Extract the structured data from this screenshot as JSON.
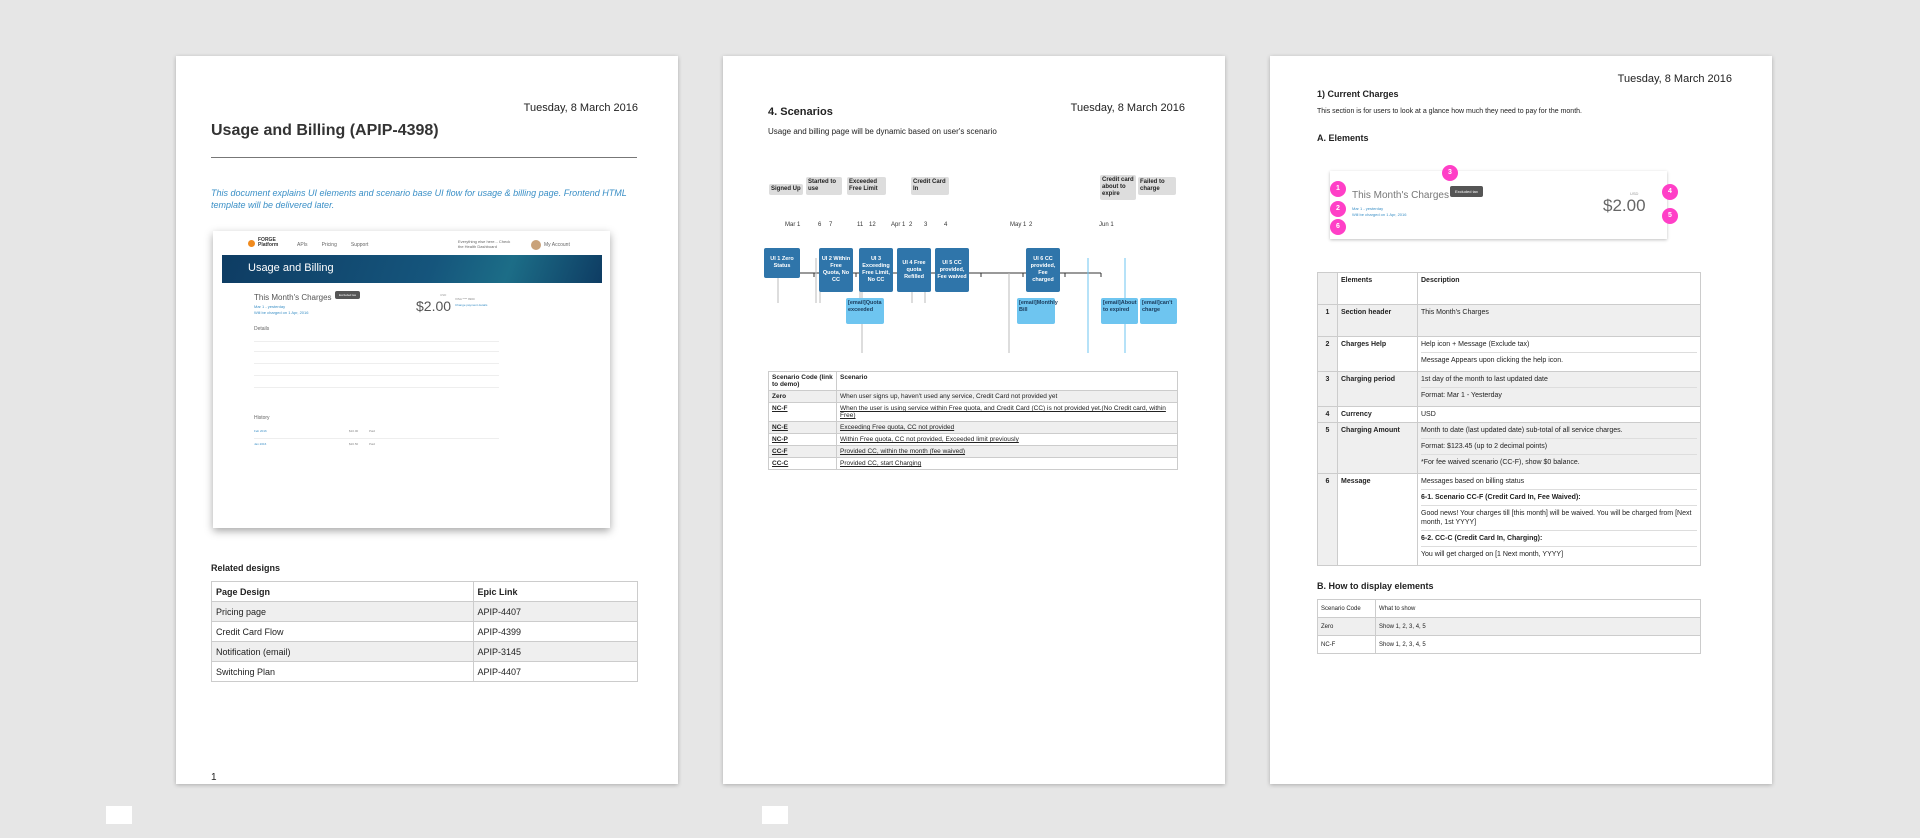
{
  "page1": {
    "date": "Tuesday, 8 March 2016",
    "title": "Usage and Billing (APIP-4398)",
    "intro": "This document explains UI elements and scenario base UI flow for usage & billing page. Frontend HTML template will be delivered later.",
    "screenshot": {
      "brand": "FORGE Platform",
      "nav": [
        "APIs",
        "Pricing",
        "Support"
      ],
      "promo": "Everything else here... Check the Health Dashboard",
      "account": "My Account",
      "banner": "Usage and Billing",
      "card_header": "This Month's Charges",
      "help_tip": "Excluded tax",
      "period_line1": "Mar 1 - yesterday",
      "period_line2": "Will be charged on 1 Apr, 2016",
      "currency": "USD",
      "amount": "$2.00",
      "card_info": "VISA **** 9900",
      "card_link": "Change payment details",
      "details_title": "Details",
      "history_title": "History",
      "history_rows": [
        {
          "month": "Feb 2016",
          "amount": "$10.00",
          "status": "Paid"
        },
        {
          "month": "Jan 2016",
          "amount": "$20.50",
          "status": "Paid"
        }
      ]
    },
    "related_heading": "Related designs",
    "related_headers": [
      "Page Design",
      "Epic Link"
    ],
    "related_rows": [
      [
        "Pricing page",
        "APIP-4407"
      ],
      [
        "Credit Card Flow",
        "APIP-4399"
      ],
      [
        "Notification (email)",
        "APIP-3145"
      ],
      [
        "Switching Plan",
        "APIP-4407"
      ]
    ],
    "page_number": "1"
  },
  "page2": {
    "date": "Tuesday, 8 March 2016",
    "title": "4. Scenarios",
    "subtitle": "Usage and billing page will be dynamic based on user's scenario",
    "events": [
      "Signed Up",
      "Started to use",
      "Exceeded Free Limit",
      "Credit Card In",
      "Credit card about to expire",
      "Failed to charge"
    ],
    "ticks": [
      "Mar 1",
      "6",
      "7",
      "11",
      "12",
      "Apr 1",
      "2",
      "3",
      "4",
      "May 1",
      "2",
      "Jun 1"
    ],
    "ui_boxes": [
      "UI 1 Zero Status",
      "UI 2 Within Free Quota, No CC",
      "UI 3 Exceeding Free Limit, No CC",
      "UI 4 Free quota Refilled",
      "UI 5 CC provided, Fee waived",
      "UI 6 CC provided, Fee charged"
    ],
    "email_boxes": [
      "[email]Quota exceeded",
      "[email]Monthly Bill",
      "[email]About to expired",
      "[email]can't charge"
    ],
    "table_headers": [
      "Scenario Code (link to demo)",
      "Scenario"
    ],
    "table_rows": [
      [
        "Zero",
        "When user signs up, haven't used any service, Credit Card not provided yet"
      ],
      [
        "NC-F",
        "When the user is using service within Free quota, and Credit Card (CC) is not provided yet.(No Credit card, within Free)"
      ],
      [
        "NC-E",
        "Exceeding Free quota, CC not provided"
      ],
      [
        "NC-P",
        "Within Free quota, CC not provided, Exceeded limit previously"
      ],
      [
        "CC-F",
        "Provided CC, within the month (fee waived)"
      ],
      [
        "CC-C",
        "Provided CC, start Charging"
      ]
    ]
  },
  "page3": {
    "date": "Tuesday, 8 March 2016",
    "heading": "1)  Current Charges",
    "intro": "This section is for users to look at a glance how much they need to pay for the month.",
    "sub_a": "A.  Elements",
    "shot": {
      "header": "This Month's Charges",
      "tip": "Excluded tax",
      "period_line1": "Mar 1 - yesterday",
      "period_line2": "Will be charged on 1 Apr, 2016",
      "currency": "USD",
      "amount": "$2.00"
    },
    "pins": [
      "1",
      "2",
      "3",
      "4",
      "5",
      "6"
    ],
    "el_headers": [
      "",
      "Elements",
      "Description"
    ],
    "el_rows": [
      {
        "num": "1",
        "name": "Section header",
        "desc": [
          "This Month's Charges"
        ]
      },
      {
        "num": "2",
        "name": "Charges Help",
        "desc": [
          "Help icon + Message (Exclude tax)",
          "Message Appears upon clicking the help icon."
        ]
      },
      {
        "num": "3",
        "name": "Charging period",
        "desc": [
          "1st day of the month to last updated date",
          "Format: Mar 1 - Yesterday"
        ]
      },
      {
        "num": "4",
        "name": "Currency",
        "desc": [
          "USD"
        ]
      },
      {
        "num": "5",
        "name": "Charging Amount",
        "desc": [
          "Month to date (last updated date) sub-total of all service charges.",
          "Format: $123.45 (up to 2 decimal points)",
          "*For fee waived scenario (CC-F), show $0 balance."
        ]
      },
      {
        "num": "6",
        "name": "Message",
        "desc": [
          "Messages based on billing status",
          "6-1. Scenario CC-F (Credit Card In, Fee Waived):",
          "Good news! Your charges till [this month] will be waived. You will be charged from [Next month, 1st YYYY]",
          "6-2. CC-C (Credit Card In, Charging):",
          "You will get charged on [1 Next month, YYYY]"
        ]
      }
    ],
    "sub_b": "B.  How to display elements",
    "how_headers": [
      "Scenario Code",
      "What to show"
    ],
    "how_rows": [
      [
        "Zero",
        "Show 1, 2, 3, 4, 5"
      ],
      [
        "NC-F",
        "Show 1, 2, 3, 4, 5"
      ]
    ]
  },
  "colors": {
    "background": "#e6e6e6",
    "link_blue": "#3a8fc6",
    "ui_box": "#2f75aa",
    "email_box": "#6ec5f0",
    "pin": "#ff3fc7",
    "banner": "#0e3c63"
  }
}
